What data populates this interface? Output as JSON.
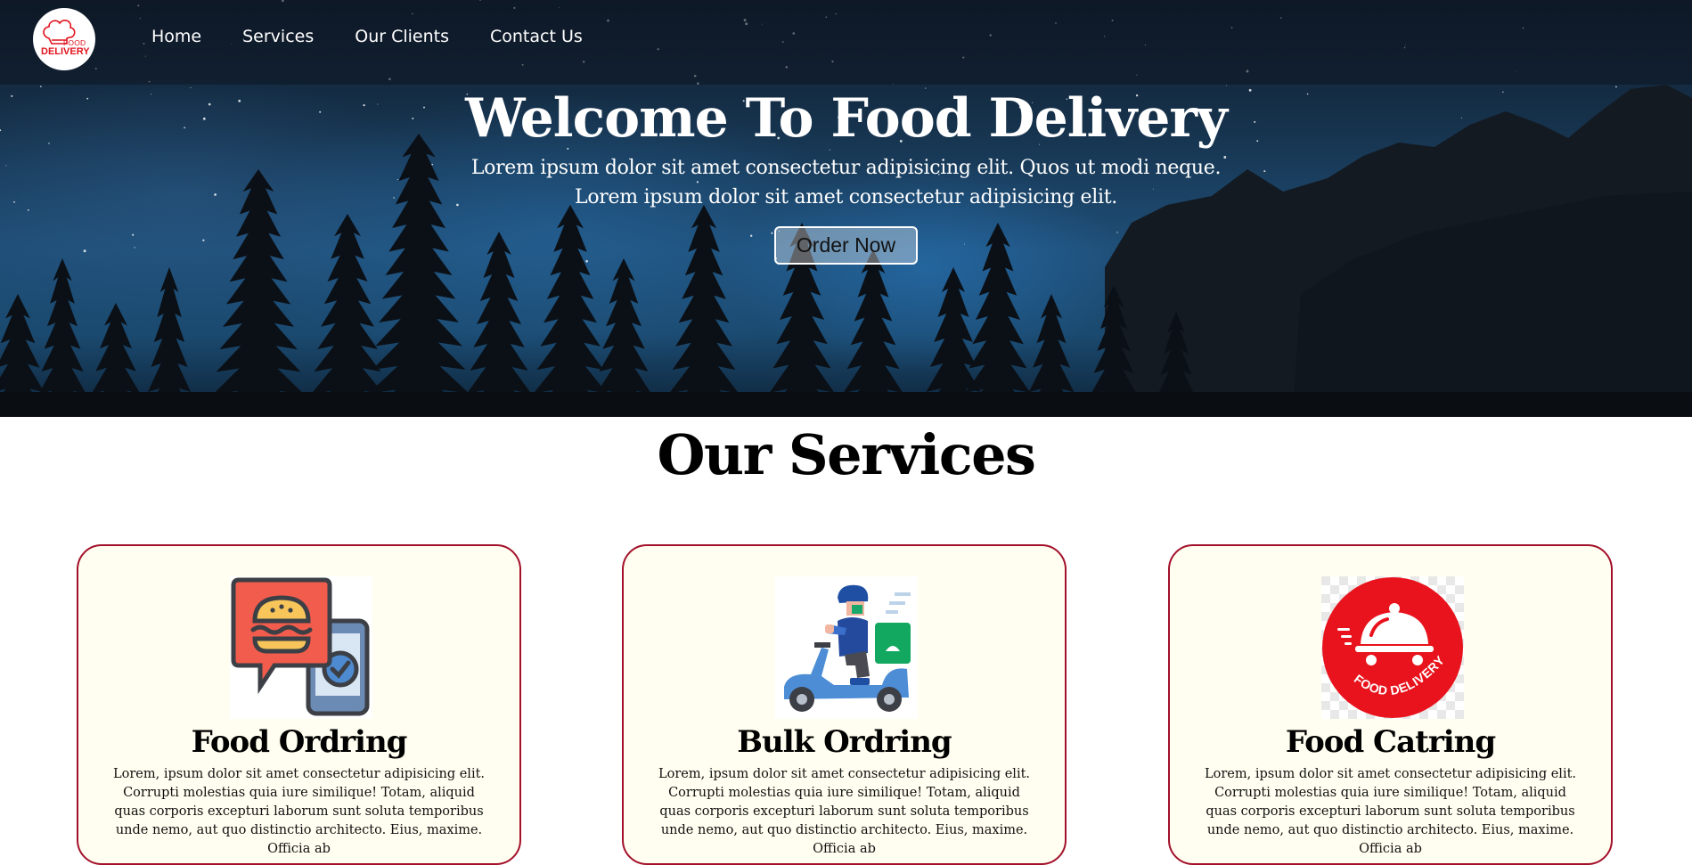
{
  "brand": {
    "logo_line1": "FOOD",
    "logo_line2": "DELIVERY",
    "color": "#e0141e"
  },
  "nav": {
    "items": [
      {
        "label": "Home"
      },
      {
        "label": "Services"
      },
      {
        "label": "Our Clients"
      },
      {
        "label": "Contact Us"
      }
    ]
  },
  "hero": {
    "title": "Welcome To Food Delivery",
    "subtitle_line1": "Lorem ipsum dolor sit amet consectetur adipisicing elit. Quos ut modi neque.",
    "subtitle_line2": "Lorem ipsum dolor sit amet consectetur adipisicing elit.",
    "cta_label": "Order Now",
    "background": "night-sky-forest-image"
  },
  "services": {
    "title": "Our Services",
    "border_color": "#a3102a",
    "cards": [
      {
        "icon": "burger-order-phone-icon",
        "title": "Food Ordring",
        "text": "Lorem, ipsum dolor sit amet consectetur adipisicing elit. Corrupti molestias quia iure similique! Totam, aliquid quas corporis excepturi laborum sunt soluta temporibus unde nemo, aut quo distinctio architecto. Eius, maxime. Officia ab"
      },
      {
        "icon": "delivery-scooter-icon",
        "title": "Bulk Ordring",
        "text": "Lorem, ipsum dolor sit amet consectetur adipisicing elit. Corrupti molestias quia iure similique! Totam, aliquid quas corporis excepturi laborum sunt soluta temporibus unde nemo, aut quo distinctio architecto. Eius, maxime. Officia ab"
      },
      {
        "icon": "food-delivery-cloche-icon",
        "icon_text": "FOOD DELIVERY",
        "title": "Food Catring",
        "text": "Lorem, ipsum dolor sit amet consectetur adipisicing elit. Corrupti molestias quia iure similique! Totam, aliquid quas corporis excepturi laborum sunt soluta temporibus unde nemo, aut quo distinctio architecto. Eius, maxime. Officia ab"
      }
    ]
  }
}
